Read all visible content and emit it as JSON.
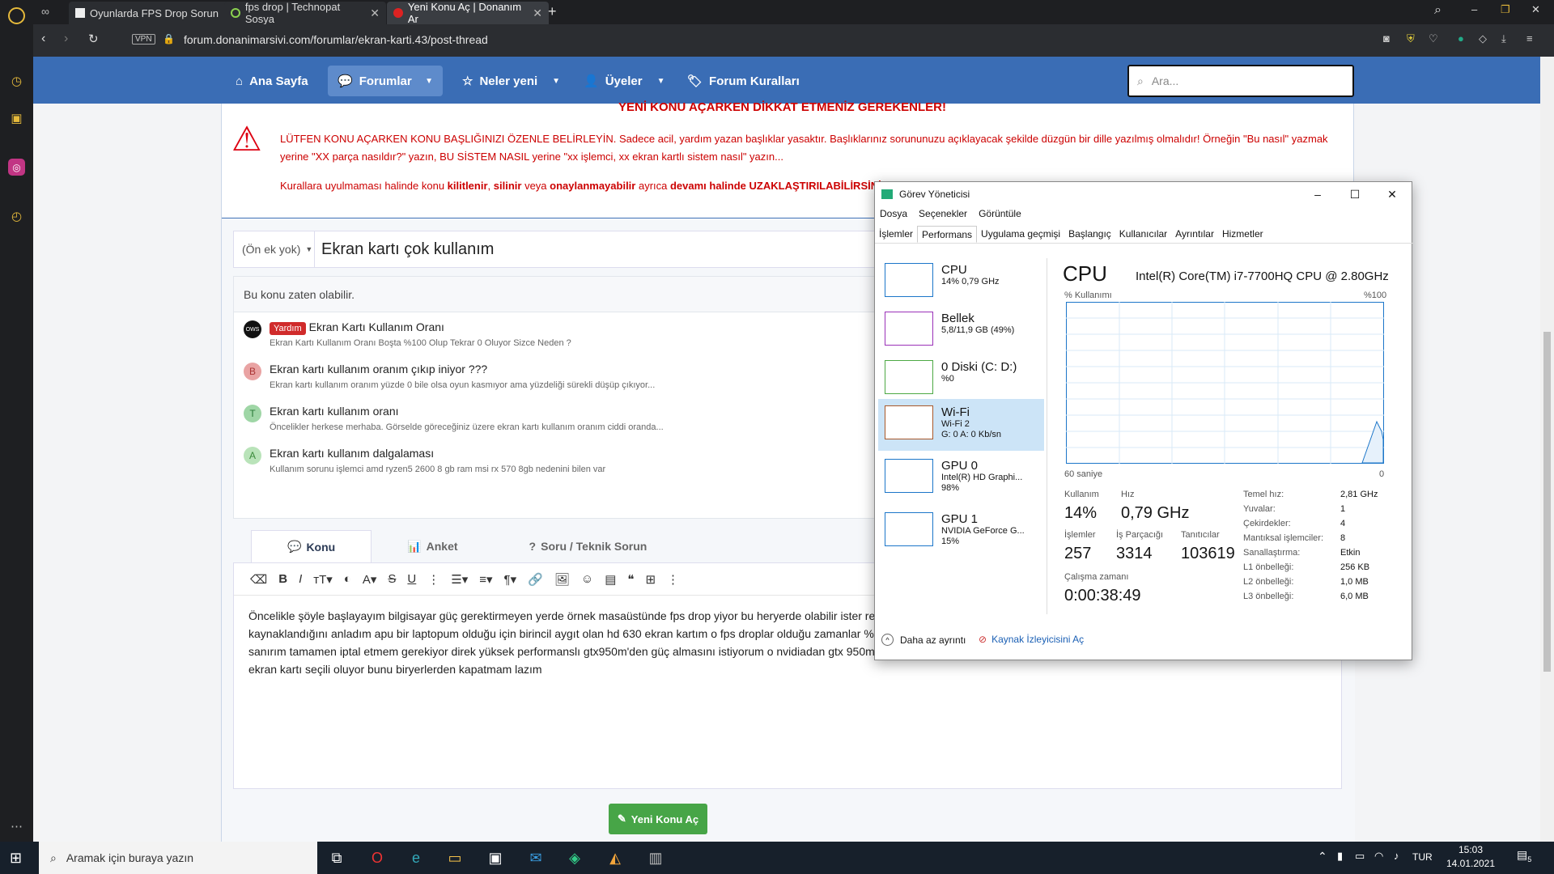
{
  "browser": {
    "tabs": [
      {
        "title": "Oyunlarda FPS Drop Sorun"
      },
      {
        "title": "fps drop | Technopat Sosya"
      },
      {
        "title": "Yeni Konu Aç | Donanım Ar"
      }
    ],
    "vpn_label": "VPN",
    "url": "forum.donanimarsivi.com/forumlar/ekran-karti.43/post-thread"
  },
  "nav": {
    "home": "Ana Sayfa",
    "forums": "Forumlar",
    "whats_new": "Neler yeni",
    "members": "Üyeler",
    "rules": "Forum Kuralları",
    "search_placeholder": "Ara..."
  },
  "notice": {
    "heading": "YENİ KONU AÇARKEN DİKKAT ETMENİZ GEREKENLER!",
    "line1": "LÜTFEN KONU AÇARKEN KONU BAŞLIĞINIZI ÖZENLE BELİRLEYİN. Sadece acil, yardım yazan başlıklar yasaktır. Başlıklarınız sorununuzu açıklayacak şekilde düzgün bir dille yazılmış olmalıdır! Örneğin \"Bu nasıl\" yazmak",
    "line2": "yerine \"XX parça nasıldır?\" yazın, BU SİSTEM NASIL yerine \"xx işlemci, xx ekran kartlı sistem nasıl\" yazın...",
    "line3_a": "Kurallara uyulmaması halinde konu ",
    "line3_b": "kilitlenir",
    "line3_c": ", ",
    "line3_d": "silinir",
    "line3_e": " veya ",
    "line3_f": "onaylanmayabilir",
    "line3_g": " ayrıca ",
    "line3_h": "devamı halinde UZAKLAŞTIRILABİLİRSİNİZ"
  },
  "form": {
    "prefix": "(Ön ek yok)",
    "title_value": "Ekran kartı çok kullanım",
    "similar_heading": "Bu konu zaten olabilir.",
    "similar": [
      {
        "avatar": "OWS",
        "badge": "Yardım",
        "title": "Ekran Kartı Kullanım Oranı",
        "sub": "Ekran Kartı Kullanım Oranı Boşta %100 Olup Tekrar 0 Oluyor Sizce Neden ?"
      },
      {
        "avatar": "B",
        "badge": "",
        "title": "Ekran kartı kullanım oranım çıkıp iniyor ???",
        "sub": "Ekran kartı kullanım oranım yüzde 0 bile olsa oyun kasmıyor ama yüzdeliği sürekli düşüp çıkıyor..."
      },
      {
        "avatar": "T",
        "badge": "",
        "title": "Ekran kartı kullanım oranı",
        "sub": "Öncelikler herkese merhaba. Görselde göreceğiniz üzere ekran kartı kullanım oranım ciddi oranda..."
      },
      {
        "avatar": "A",
        "badge": "",
        "title": "Ekran kartı kullanım dalgalaması",
        "sub": "Kullanım sorunu işlemci amd ryzen5 2600 8 gb ram msi rx 570 8gb nedenini bilen var"
      }
    ],
    "tabs": [
      "Konu",
      "Anket",
      "Soru / Teknik Sorun"
    ],
    "body_line1": "Öncelikle şöyle başlayayım bilgisayar güç gerektirmeyen yerde örnek masaüstünde fps drop yiyor bu heryerde olabilir ister re",
    "body_line2": "kaynaklandığını anladım apu bir laptopum olduğu için birincil aygıt olan hd 630 ekran kartım o fps droplar olduğu zamanlar %",
    "body_line3": "sanırım tamamen iptal etmem gerekiyor direk yüksek performanslı gtx950m'den güç almasını istiyorum o nvidiadan gtx 950m i seç falan demeyin yaptım onları olmuyor hala normal ekranı veren ekran kartı birincil",
    "body_line4": "ekran kartı seçili oluyor bunu biryerlerden kapatmam lazım",
    "submit": "Yeni Konu Aç"
  },
  "taskmanager": {
    "title": "Görev Yöneticisi",
    "menu": [
      "Dosya",
      "Seçenekler",
      "Görüntüle"
    ],
    "tabs": [
      "İşlemler",
      "Performans",
      "Uygulama geçmişi",
      "Başlangıç",
      "Kullanıcılar",
      "Ayrıntılar",
      "Hizmetler"
    ],
    "resources": [
      {
        "name": "CPU",
        "line1": "14% 0,79 GHz",
        "line2": "",
        "color": "#1c76c9"
      },
      {
        "name": "Bellek",
        "line1": "5,8/11,9 GB (49%)",
        "line2": "",
        "color": "#9a31b8"
      },
      {
        "name": "0 Diski (C: D:)",
        "line1": "%0",
        "line2": "",
        "color": "#4da944"
      },
      {
        "name": "Wi-Fi",
        "line1": "Wi-Fi 2",
        "line2": "G: 0 A: 0 Kb/sn",
        "color": "#a9582a"
      },
      {
        "name": "GPU 0",
        "line1": "Intel(R) HD Graphi...",
        "line2": "98%",
        "color": "#1c76c9"
      },
      {
        "name": "GPU 1",
        "line1": "NVIDIA GeForce G...",
        "line2": "15%",
        "color": "#1c76c9"
      }
    ],
    "cpu_heading": "CPU",
    "cpu_model": "Intel(R) Core(TM) i7-7700HQ CPU @ 2.80GHz",
    "graph_label": "% Kullanımı",
    "graph_max": "%100",
    "graph_time": "60 saniye",
    "graph_min": "0",
    "usage_label": "Kullanım",
    "usage": "14%",
    "speed_label": "Hız",
    "speed": "0,79 GHz",
    "proc_label": "İşlemler",
    "proc": "257",
    "threads_label": "İş Parçacığı",
    "threads": "3314",
    "handles_label": "Tanıtıcılar",
    "handles": "103619",
    "uptime_label": "Çalışma zamanı",
    "uptime": "0:00:38:49",
    "specs": [
      {
        "k": "Temel hız:",
        "v": "2,81 GHz"
      },
      {
        "k": "Yuvalar:",
        "v": "1"
      },
      {
        "k": "Çekirdekler:",
        "v": "4"
      },
      {
        "k": "Mantıksal işlemciler:",
        "v": "8"
      },
      {
        "k": "Sanallaştırma:",
        "v": "Etkin"
      },
      {
        "k": "L1 önbelleği:",
        "v": "256 KB"
      },
      {
        "k": "L2 önbelleği:",
        "v": "1,0 MB"
      },
      {
        "k": "L3 önbelleği:",
        "v": "6,0 MB"
      }
    ],
    "less_details": "Daha az ayrıntı",
    "resmon": "Kaynak İzleyicisini Aç"
  },
  "taskbar": {
    "search_placeholder": "Aramak için buraya yazın",
    "lang": "TUR",
    "time": "15:03",
    "date": "14.01.2021",
    "notif_count": "5"
  }
}
